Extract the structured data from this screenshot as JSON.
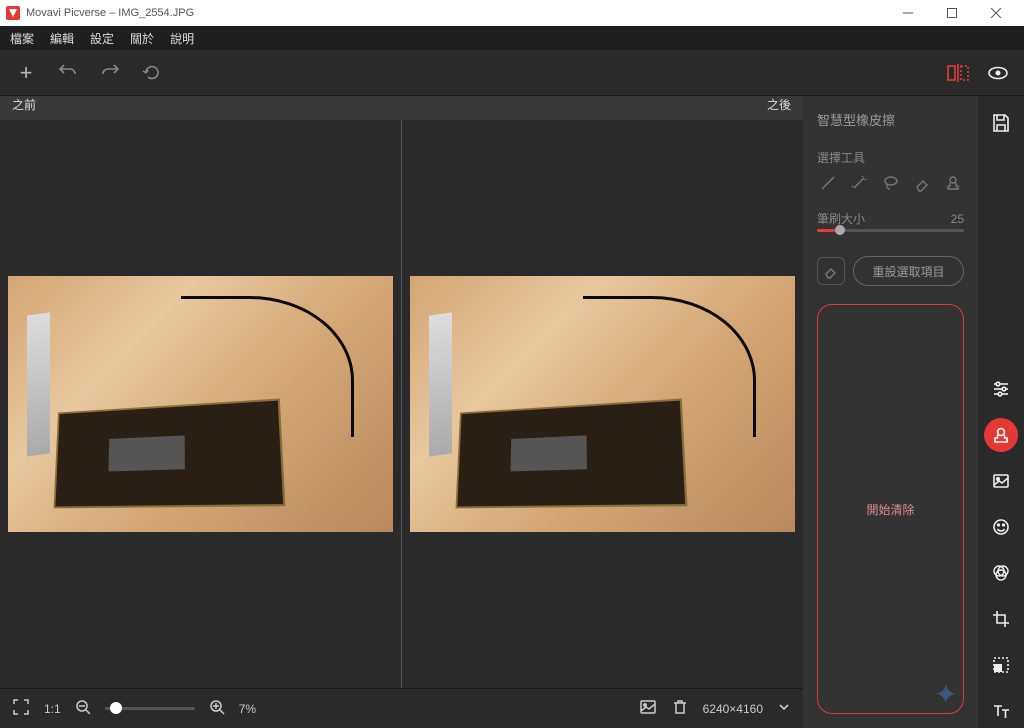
{
  "window": {
    "title": "Movavi Picverse – IMG_2554.JPG"
  },
  "menu": {
    "file": "檔案",
    "edit": "編輯",
    "settings": "設定",
    "about": "關於",
    "help": "說明"
  },
  "compare": {
    "before": "之前",
    "after": "之後"
  },
  "panel": {
    "title": "智慧型橡皮擦",
    "select_tool": "選擇工具",
    "brush_size_label": "筆刷大小",
    "brush_size_value": "25",
    "reset_selection": "重設選取項目",
    "start_erase": "開始清除"
  },
  "bottom": {
    "zoom_percent": "7%",
    "dimensions": "6240×4160"
  }
}
